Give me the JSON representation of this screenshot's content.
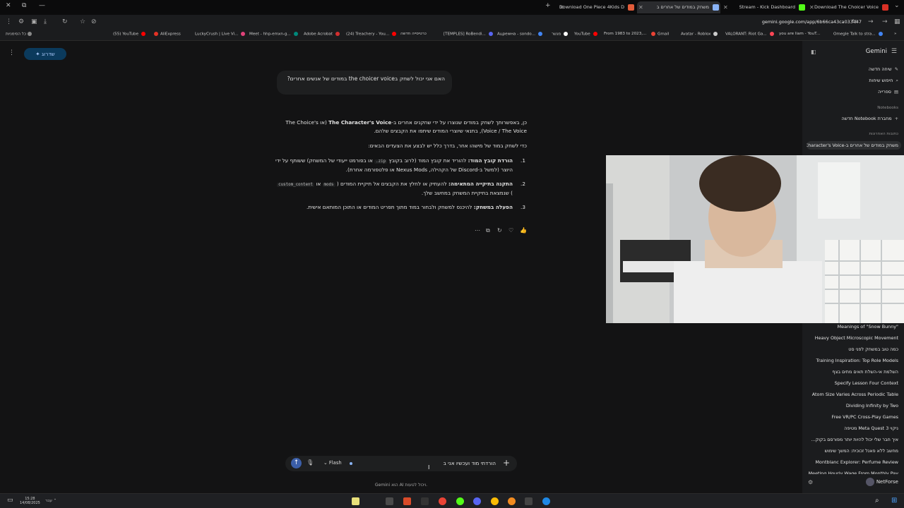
{
  "tabs": [
    {
      "label": "Download One Piece 4Kids D",
      "color": "#e25c3a"
    },
    {
      "label": "משחק במודים של אחרים ב",
      "color": "#8ab4f8",
      "active": true
    },
    {
      "label": "Stream - Kick Dashboard",
      "color": "#53fc18"
    },
    {
      "label": "Download The Choicer Voice",
      "color": "#d93025"
    }
  ],
  "url": "gemini.google.com/app/6b66ca43ca033747",
  "bookmarks": [
    {
      "label": "כל הסימניות",
      "color": "#888888"
    },
    {
      "label": "(55) YouTube",
      "color": "#ff0000"
    },
    {
      "label": "AliExpress",
      "color": "#e43225"
    },
    {
      "label": "LuckyCrush | Live Vi...",
      "color": "#e0427a"
    },
    {
      "label": "Meet - hhp-emxn-g...",
      "color": "#00897b"
    },
    {
      "label": "Adobe Acrobat",
      "color": "#d32f2f"
    },
    {
      "label": "(24) Treachery - You...",
      "color": "#ff0000"
    },
    {
      "label": "כרטיסייה חדשה",
      "color": "#888888"
    },
    {
      "label": "[TEMPLES] RoBendi...",
      "color": "#5865f2"
    },
    {
      "label": "Ацреwна - sоndо...",
      "color": "#4285f4"
    },
    {
      "label": "מגשר",
      "color": "#ffffff"
    },
    {
      "label": "YouTube",
      "color": "#ff0000"
    },
    {
      "label": "From 1983 to 2023,...",
      "color": "#ff0000"
    },
    {
      "label": "Gmail",
      "color": "#ea4335"
    },
    {
      "label": "Avatar - Roblox",
      "color": "#cccccc"
    },
    {
      "label": "VALORANT: Riot Ga...",
      "color": "#ff4655"
    },
    {
      "label": "you are liam - YouT...",
      "color": "#ff0000"
    },
    {
      "label": "Omegle Talk to stra...",
      "color": "#4285f4"
    }
  ],
  "main": {
    "upgrade_label": "שדרוג",
    "user_message": "האם אני יכול לשחק בthe choicer voice במודים של אנשים אחרים?",
    "response": {
      "intro_a": "כן, באפשרותך לשחק במודים שנוצרו על ידי שחקנים אחרים ב-",
      "intro_bold": "The Character's Voice",
      "intro_b": " (או The Choice's Voice / The Voice), בתנאי שיוצרי המודים שיתפו את הקבצים שלהם.",
      "lead": "כדי לשחק במוד של מישהו אחר, בדרך כלל יש לבצע את הצעדים הבאים:",
      "steps": [
        {
          "num": "1.",
          "title": "הורדת קובץ המוד:",
          "text_a": " להוריד את קובץ המוד (לרוב בקובץ ",
          "code": "zip.",
          "text_b": " או בפורמט ייעודי של המשחק) ששותף על ידי היוצר (למשל ב-Discord של הקהילה, Nexus Mods או פלטפורמה אחרת)."
        },
        {
          "num": "2.",
          "title": "התקנה בתיקייה המתאימה:",
          "text_a": " להעתיק או לחלץ את הקבצים אל תיקיית המודים ( ",
          "code": "mods",
          "text_b": " או ",
          "code2": "custom_content",
          "text_c": " ) שנמצאת בתיקיית המשחק במחשב שלך."
        },
        {
          "num": "3.",
          "title": "הפעלה במשחק:",
          "text_a": " להיכנס למשחק ולבחור במוד מתוך תפריט המודים או התוכן המותאם אישית.",
          "code": "",
          "text_b": ""
        }
      ]
    },
    "input_text": "הורדתי מוד ועכשיו אני ב",
    "model_label": "Flash",
    "disclaimer": "Gemini הוא AI ויכול לטעות."
  },
  "sidebar": {
    "brand": "Gemini",
    "new_chat": "שיחה חדשה",
    "search_chats": "חיפוש שיחות",
    "library": "ספרייה",
    "notebooks_header": "Notebooks",
    "new_notebook": "מחברת Notebook חדשה",
    "recent_header": "כתובות האחרונות",
    "history": [
      "משחק במודים של אחרים ב-The Character's Voice",
      "\"Meanings of \"Snow Bunny",
      "Heavy Object Microscopic Movement",
      "כמה טוב במשחק לפני סט",
      "Training Inspiration: Top Role Models",
      "השלמת אי-השלת תאים מתים בצף",
      "Specify Lesson Four Context",
      "Atom Size Varies Across Periodic Table",
      "Dividing Infinity by Two",
      "Free VR/PC Cross-Play Games",
      "ניקוי Meta Quest 3 מטיפה",
      "איך חבר שלי יכול להיות יותר מפורסם בקוק...",
      "מחשב ללא פאנל זכוכית: המשך שימוש",
      "Montblanc Explorer: Perfume Review",
      "Meeting Hourly Wage From Monthly Pay"
    ],
    "account_name": "NetForse"
  },
  "taskbar": {
    "time": "15:28",
    "date": "14/08/2025",
    "tray_text": "עבר"
  }
}
